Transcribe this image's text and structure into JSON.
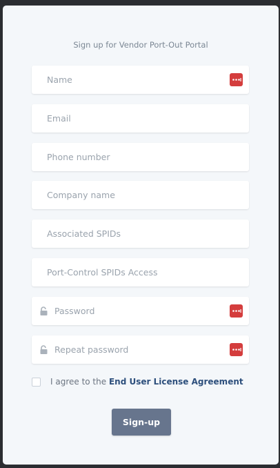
{
  "form": {
    "title": "Sign up for Vendor Port-Out Portal",
    "fields": [
      {
        "placeholder": "Name",
        "value": ""
      },
      {
        "placeholder": "Email",
        "value": ""
      },
      {
        "placeholder": "Phone number",
        "value": ""
      },
      {
        "placeholder": "Company name",
        "value": ""
      },
      {
        "placeholder": "Associated SPIDs",
        "value": ""
      },
      {
        "placeholder": "Port-Control SPIDs Access",
        "value": ""
      },
      {
        "placeholder": "Password",
        "value": ""
      },
      {
        "placeholder": "Repeat password",
        "value": ""
      }
    ],
    "agree": {
      "prefix": "I agree to the",
      "link": "End User License Agreement",
      "checked": false
    },
    "submit_label": "Sign-up"
  },
  "icons": {
    "password_manager": "password-manager-icon",
    "lock": "lock-icon",
    "checkbox": "checkbox-icon"
  },
  "colors": {
    "background": "#2b2d31",
    "card": "#f4f7fa",
    "button": "#67758d",
    "link": "#2d4f7c",
    "password_manager_icon": "#d43d3d"
  }
}
